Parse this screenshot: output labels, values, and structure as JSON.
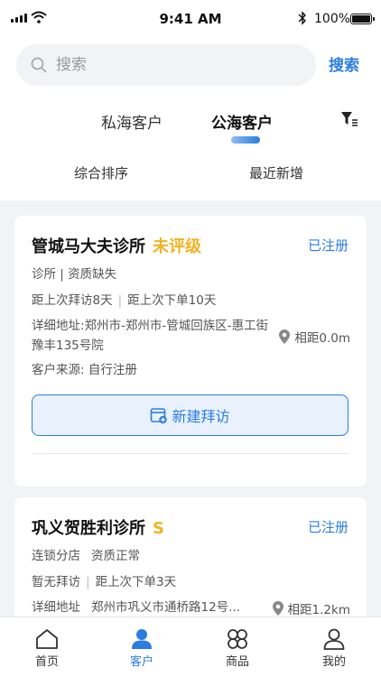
{
  "status_bar": {
    "time": "9:41 AM",
    "battery": "100%"
  },
  "search": {
    "placeholder": "搜索",
    "button_label": "搜索"
  },
  "tabs": [
    {
      "label": "私海客户",
      "active": false
    },
    {
      "label": "公海客户",
      "active": true
    }
  ],
  "sort": {
    "combined": "综合排序",
    "recent": "最近新增"
  },
  "customers": [
    {
      "name": "管城马大夫诊所",
      "rating": "未评级",
      "status": "已注册",
      "type_qualification": "诊所 | 资质缺失",
      "last_visit": "距上次拜访8天",
      "last_order": "距上次下单10天",
      "address": "详细地址:郑州市-郑州市-管城回族区-惠工街豫丰135号院",
      "distance": "相距0.0m",
      "source": "客户来源: 自行注册",
      "action_label": "新建拜访"
    },
    {
      "name": "巩义贺胜利诊所",
      "rating": "S",
      "status": "已注册",
      "type": "连锁分店",
      "qualification": "资质正常",
      "last_visit": "暂无拜访",
      "last_order": "距上次下单3天",
      "address_label": "详细地址",
      "address": "郑州市巩义市通桥路12号...",
      "distance": "相距1.2km"
    }
  ],
  "tab_bar": [
    {
      "label": "首页",
      "icon": "home-icon",
      "active": false
    },
    {
      "label": "客户",
      "icon": "customer-icon",
      "active": true
    },
    {
      "label": "商品",
      "icon": "goods-icon",
      "active": false
    },
    {
      "label": "我的",
      "icon": "profile-icon",
      "active": false
    }
  ],
  "colors": {
    "accent": "#2b7de0",
    "rating": "#f0b323",
    "background": "#f2f3f5"
  }
}
